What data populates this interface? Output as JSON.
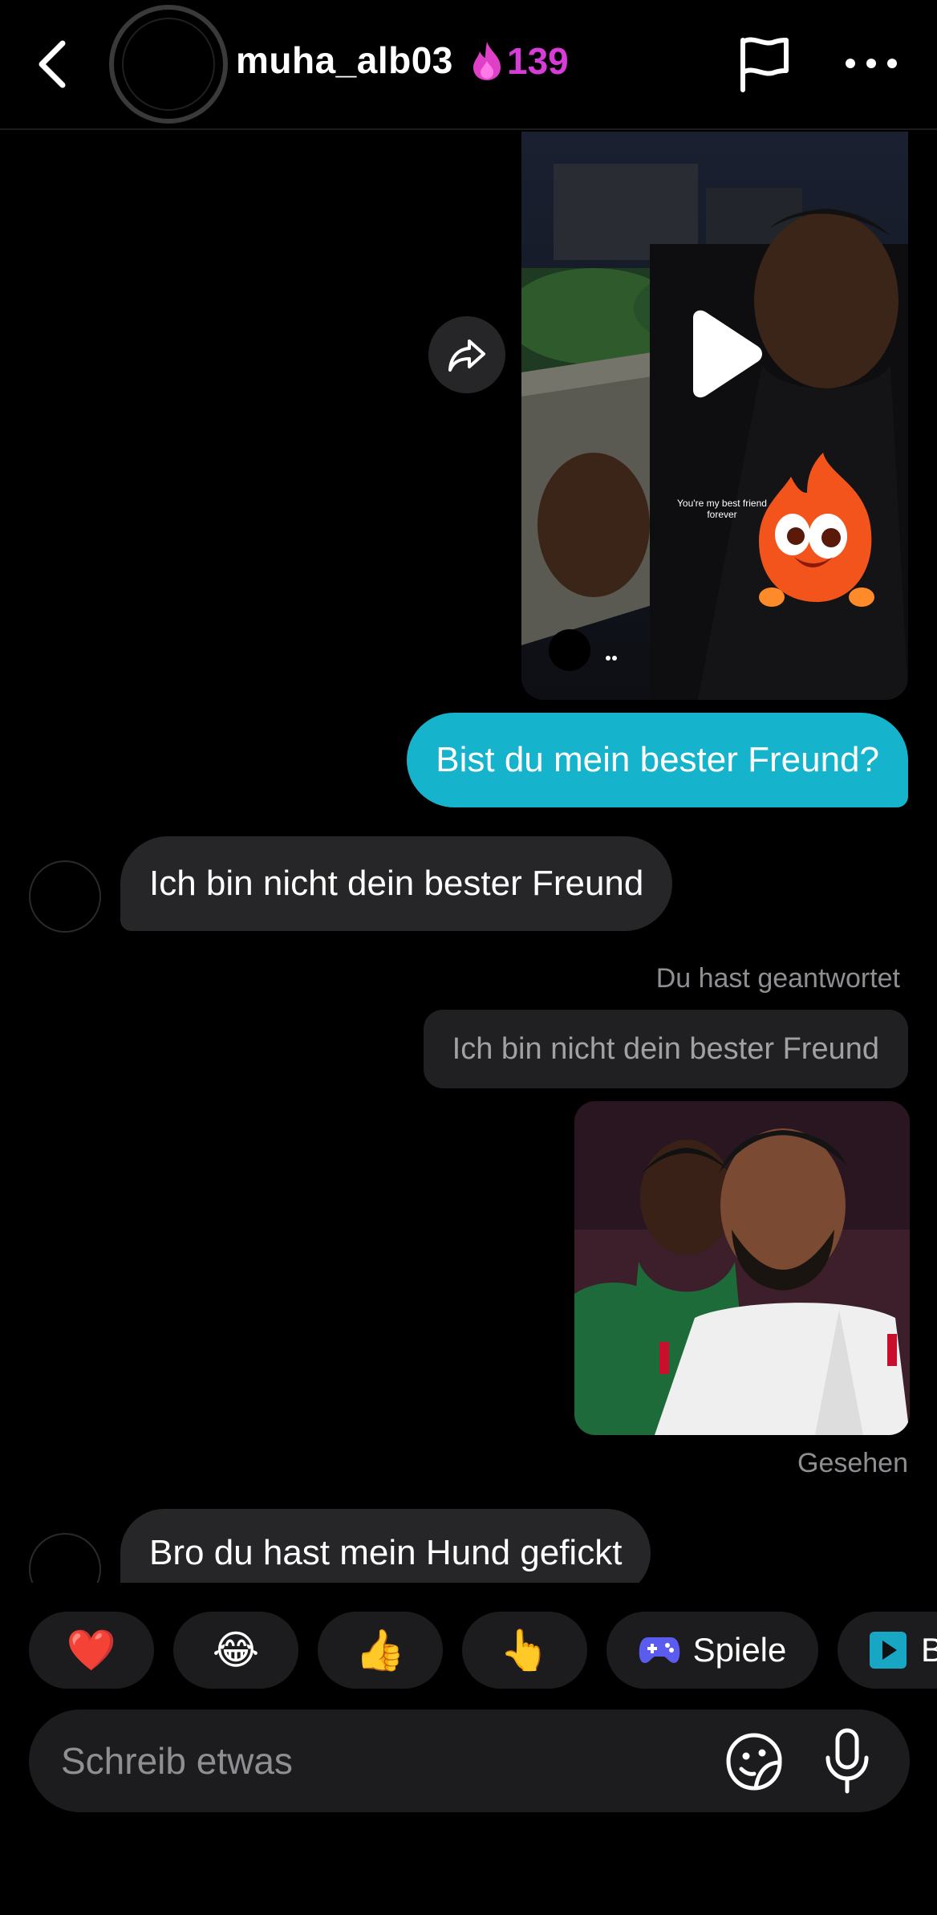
{
  "header": {
    "username": "muha_alb03",
    "streak_count": "139",
    "streak_color": "#d83cd8"
  },
  "icons": {
    "back": "chevron-left-icon",
    "flag": "flag-icon",
    "more": "more-horizontal-icon",
    "share": "share-forward-icon",
    "play": "play-icon",
    "streak": "flame-icon",
    "sticker": "sticker-icon",
    "mic": "microphone-icon"
  },
  "video_message": {
    "caption": "You're my best friend forever"
  },
  "messages": [
    {
      "direction": "outgoing",
      "text": "Bist du mein bester Freund?"
    },
    {
      "direction": "incoming",
      "text": "Ich bin nicht dein bester Freund"
    },
    {
      "direction": "incoming",
      "text": "Bro du hast mein Hund gefickt"
    }
  ],
  "reply": {
    "label": "Du hast geantwortet",
    "quoted": "Ich bin nicht dein bester Freund"
  },
  "seen_status": "Gesehen",
  "quick_reactions": [
    {
      "emoji": "❤️"
    },
    {
      "emoji": "😂"
    },
    {
      "emoji": "👍"
    },
    {
      "emoji": "👆"
    },
    {
      "label": "Spiele",
      "icon": "gamepad-icon"
    },
    {
      "label": "B",
      "icon": "play-square-icon"
    }
  ],
  "composer": {
    "placeholder": "Schreib etwas"
  },
  "colors": {
    "outgoing_bubble": "#16b4cc",
    "incoming_bubble": "#262628",
    "background": "#000000"
  }
}
